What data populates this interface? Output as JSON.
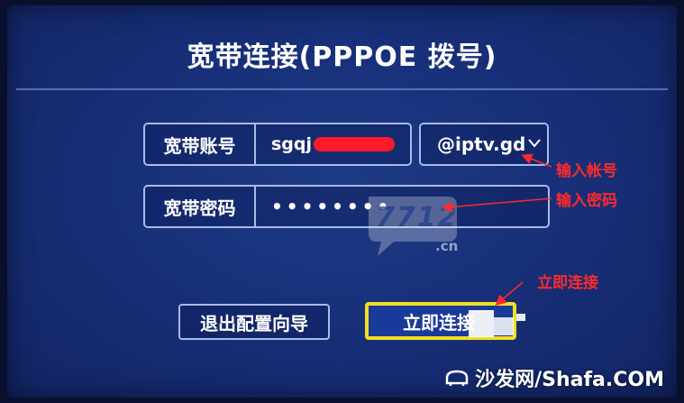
{
  "page": {
    "title": "宽带连接(PPPOE 拨号)"
  },
  "form": {
    "account": {
      "label": "宽带账号",
      "value_prefix": "sgqj"
    },
    "password": {
      "label": "宽带密码",
      "value": "••••••••"
    },
    "domain_select": {
      "selected": "@iptv.gd",
      "icon": "chevron-down-icon"
    }
  },
  "buttons": {
    "exit_wizard": "退出配置向导",
    "connect_now": "立即连接"
  },
  "annotations": {
    "enter_account": "输入帐号",
    "enter_password": "输入密码",
    "connect_now": "立即连接",
    "color": "#ff2a2a"
  },
  "watermarks": {
    "center_logo_icon": "speech-bubble-logo-icon",
    "center_logo_text": "7712",
    "center_logo_domain": ".cn",
    "bottom_logo_text": "沙发网/Shafa.COM",
    "bottom_logo_icon": "sofa-logo-icon"
  },
  "colors": {
    "background": "#18307a",
    "focus_border": "#f2df21",
    "field_border": "#a9bbe6"
  }
}
